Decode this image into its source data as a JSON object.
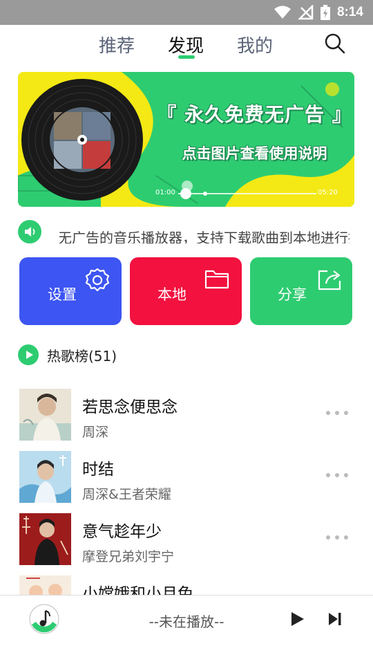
{
  "status_bar": {
    "time": "8:14"
  },
  "nav": {
    "tabs": [
      {
        "label": "推荐"
      },
      {
        "label": "发现"
      },
      {
        "label": "我的"
      }
    ],
    "active_tab": "发现",
    "accent": "#2ecc71"
  },
  "banner": {
    "title": "『 永久免费无广告 』",
    "subtitle": "点击图片查看使用说明",
    "time_start": "01:00",
    "time_end": "05:20"
  },
  "notice": {
    "text": "无广告的音乐播放器，支持下载歌曲到本地进行播放"
  },
  "actions": [
    {
      "label": "设置",
      "color": "#3d55f2",
      "icon": "gear-icon"
    },
    {
      "label": "本地",
      "color": "#f2113f",
      "icon": "folder-icon"
    },
    {
      "label": "分享",
      "color": "#2ecc71",
      "icon": "share-icon"
    }
  ],
  "hot": {
    "title": "热歌榜(51)"
  },
  "songs": [
    {
      "title": "若思念便思念",
      "artist": "周深"
    },
    {
      "title": "时结",
      "artist": "周深&王者荣耀"
    },
    {
      "title": "意气趁年少",
      "artist": "摩登兄弟刘宇宁"
    },
    {
      "title": "小嫦娥和小月兔",
      "artist": ""
    }
  ],
  "player": {
    "status": "--未在播放--"
  }
}
